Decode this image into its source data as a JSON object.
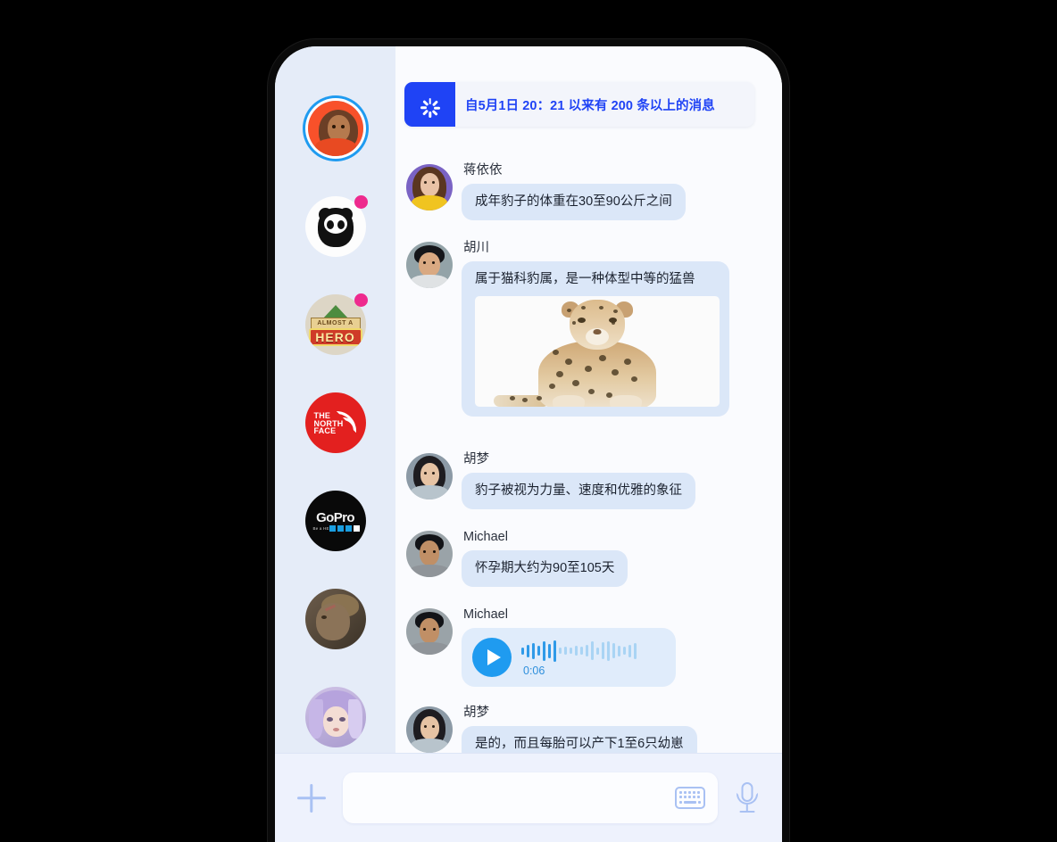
{
  "banner": {
    "icon": "sparkle-icon",
    "text": "自5月1日 20：21 以来有 200 条以上的消息",
    "accent_color": "#1f43f5"
  },
  "sidebar": {
    "items": [
      {
        "name": "avatar-illustrated-person",
        "label": "",
        "selected": true,
        "badge": false,
        "kind": "person-orange"
      },
      {
        "name": "avatar-wwf-panda",
        "label": "",
        "selected": false,
        "badge": true,
        "kind": "wwf"
      },
      {
        "name": "avatar-almost-a-hero",
        "label": "ALMOST A",
        "sub": "HERO",
        "selected": false,
        "badge": true,
        "kind": "hero"
      },
      {
        "name": "avatar-the-north-face",
        "label": "THE\nNORTH\nFACE",
        "selected": false,
        "badge": false,
        "kind": "tnf"
      },
      {
        "name": "avatar-gopro",
        "label": "GoPro",
        "sub": "Be a HERO",
        "selected": false,
        "badge": false,
        "kind": "gopro"
      },
      {
        "name": "avatar-warrior-character",
        "label": "",
        "selected": false,
        "badge": false,
        "kind": "warrior"
      },
      {
        "name": "avatar-anime-character",
        "label": "",
        "selected": false,
        "badge": false,
        "kind": "anime"
      }
    ]
  },
  "chat": {
    "messages": [
      {
        "sender": "蒋依依",
        "text": "成年豹子的体重在30至90公斤之间",
        "type": "text",
        "avatar": "woman-yellow"
      },
      {
        "sender": "胡川",
        "text": "属于猫科豹属，是一种体型中等的猛兽",
        "type": "image",
        "image_alt": "leopard-photo",
        "avatar": "man-teal"
      },
      {
        "sender": "胡梦",
        "text": "豹子被视为力量、速度和优雅的象征",
        "type": "text",
        "avatar": "woman-gray"
      },
      {
        "sender": "Michael",
        "text": "怀孕期大约为90至105天",
        "type": "text",
        "avatar": "man-gray"
      },
      {
        "sender": "Michael",
        "text": "",
        "type": "voice",
        "duration": "0:06",
        "avatar": "man-gray"
      },
      {
        "sender": "胡梦",
        "text": "是的，而且每胎可以产下1至6只幼崽",
        "type": "text",
        "avatar": "woman-gray"
      }
    ],
    "bubble_color": "#dbe7f8",
    "voice_accent": "#1f9bf0"
  },
  "composer": {
    "add_label": "+",
    "input_value": "",
    "input_placeholder": "",
    "keyboard_icon": "keyboard-icon",
    "mic_icon": "microphone-icon",
    "icon_color": "#a9c1f3"
  }
}
